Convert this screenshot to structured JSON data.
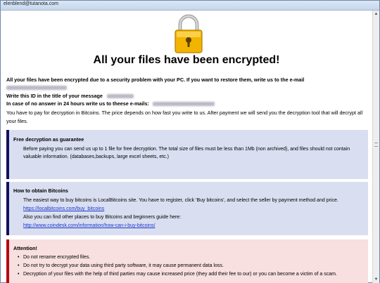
{
  "window": {
    "title": "elenblend@tutanota.com"
  },
  "icons": {
    "lock": "padlock-icon"
  },
  "header": {
    "headline": "All your files have been encrypted!"
  },
  "intro": {
    "line1": "All your files have been encrypted due to a security problem with your PC. If you want to restore them, write us to the e-mail",
    "line_id": "Write this ID in the title of your message",
    "line_noanswer": "In case of no answer in 24 hours write us to theese e-mails:",
    "line_pay": "You have to pay for decryption in Bitcoins. The price depends on how fast you write to us. After payment we will send you the decryption tool that will decrypt all your files."
  },
  "free_decryption": {
    "title": "Free decryption as guarantee",
    "text": "Before paying you can send us up to 1 file for free decryption. The total size of files must be less than 1Mb (non archived), and files should not contain valuable information. (databases,backups, large excel sheets, etc.)"
  },
  "obtain_bitcoins": {
    "title": "How to obtain Bitcoins",
    "text1": "The easiest way to buy bitcoins is LocalBitcoins site. You have to register, click 'Buy bitcoins', and select the seller by payment method and price.",
    "link1": "https://localbitcoins.com/buy_bitcoins",
    "text2": "Also you can find other places to buy Bitcoins and beginners guide here:",
    "link2": "http://www.coindesk.com/information/how-can-i-buy-bitcoins/"
  },
  "attention": {
    "title": "Attention!",
    "items": [
      "Do not rename encrypted files.",
      "Do not try to decrypt your data using third party software, it may cause permanent data loss.",
      "Decryption of your files with the help of third parties may cause increased price (they add their fee to our) or you can become a victim of a scam."
    ]
  },
  "colors": {
    "info_box_bg": "#d9dff1",
    "info_box_border": "#12115e",
    "attention_bg": "#f8dfe0",
    "attention_border": "#b50a12",
    "link": "#1a35c8",
    "lock_gold": "#f2b400"
  }
}
